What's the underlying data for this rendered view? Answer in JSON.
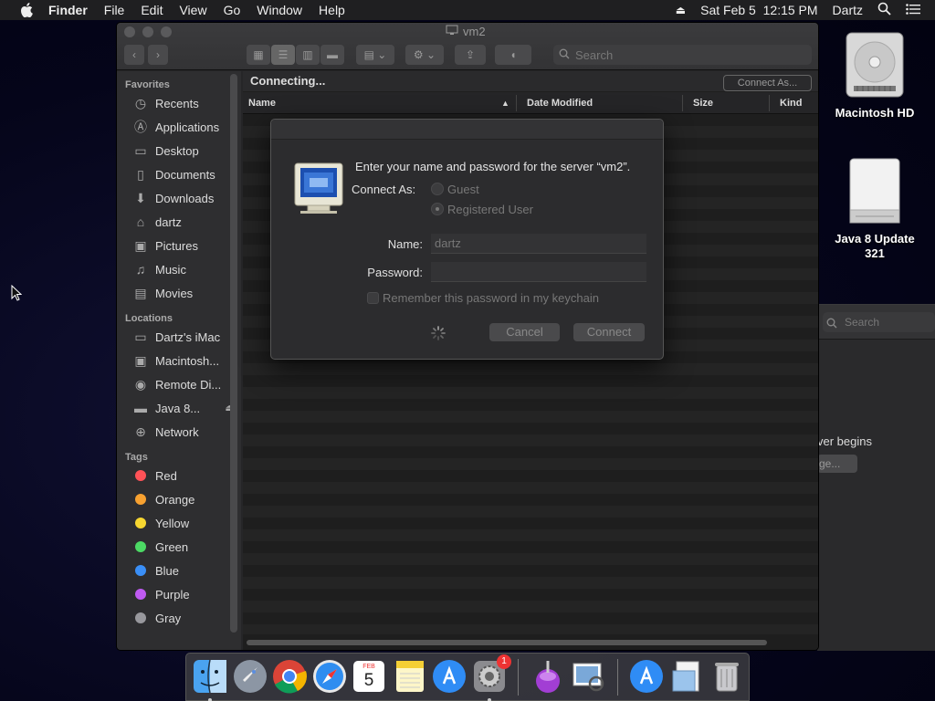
{
  "menubar": {
    "app": "Finder",
    "items": [
      "File",
      "Edit",
      "View",
      "Go",
      "Window",
      "Help"
    ],
    "datetime": "Sat Feb 5  12:15 PM",
    "user": "Dartz"
  },
  "desktop": {
    "icons": [
      {
        "label": "Macintosh HD",
        "icon": "hard-drive-icon"
      },
      {
        "label": "Java 8 Update 321",
        "icon": "disk-image-icon"
      }
    ],
    "bg_window": {
      "search_placeholder": "Search",
      "text": "ver begins",
      "button": "ge..."
    }
  },
  "finder": {
    "title": "vm2",
    "search_placeholder": "Search",
    "status": "Connecting...",
    "connect_as_button": "Connect As...",
    "columns": [
      "Name",
      "Date Modified",
      "Size",
      "Kind"
    ],
    "sidebar": {
      "favorites_header": "Favorites",
      "favorites": [
        {
          "label": "Recents",
          "icon": "clock-icon"
        },
        {
          "label": "Applications",
          "icon": "applications-icon"
        },
        {
          "label": "Desktop",
          "icon": "desktop-icon"
        },
        {
          "label": "Documents",
          "icon": "document-icon"
        },
        {
          "label": "Downloads",
          "icon": "download-icon"
        },
        {
          "label": "dartz",
          "icon": "home-icon"
        },
        {
          "label": "Pictures",
          "icon": "camera-icon"
        },
        {
          "label": "Music",
          "icon": "music-icon"
        },
        {
          "label": "Movies",
          "icon": "film-icon"
        }
      ],
      "locations_header": "Locations",
      "locations": [
        {
          "label": "Dartz's iMac",
          "icon": "computer-icon"
        },
        {
          "label": "Macintosh...",
          "icon": "hard-drive-icon"
        },
        {
          "label": "Remote Di...",
          "icon": "disc-icon"
        },
        {
          "label": "Java 8...",
          "icon": "disk-icon"
        },
        {
          "label": "Network",
          "icon": "globe-icon"
        }
      ],
      "tags_header": "Tags",
      "tags": [
        {
          "label": "Red",
          "color": "#ff5257"
        },
        {
          "label": "Orange",
          "color": "#f7a130"
        },
        {
          "label": "Yellow",
          "color": "#f6d630"
        },
        {
          "label": "Green",
          "color": "#4cd964"
        },
        {
          "label": "Blue",
          "color": "#3a8ff7"
        },
        {
          "label": "Purple",
          "color": "#bf5af2"
        },
        {
          "label": "Gray",
          "color": "#98989d"
        }
      ]
    }
  },
  "dialog": {
    "prompt": "Enter your name and password for the server “vm2”.",
    "connect_as_label": "Connect As:",
    "option_guest": "Guest",
    "option_registered": "Registered User",
    "name_label": "Name:",
    "name_value": "dartz",
    "password_label": "Password:",
    "password_value": "",
    "remember_label": "Remember this password in my keychain",
    "cancel_button": "Cancel",
    "connect_button": "Connect"
  },
  "dock": {
    "calendar_day": "5",
    "calendar_month": "FEB",
    "badge_count": "1"
  }
}
